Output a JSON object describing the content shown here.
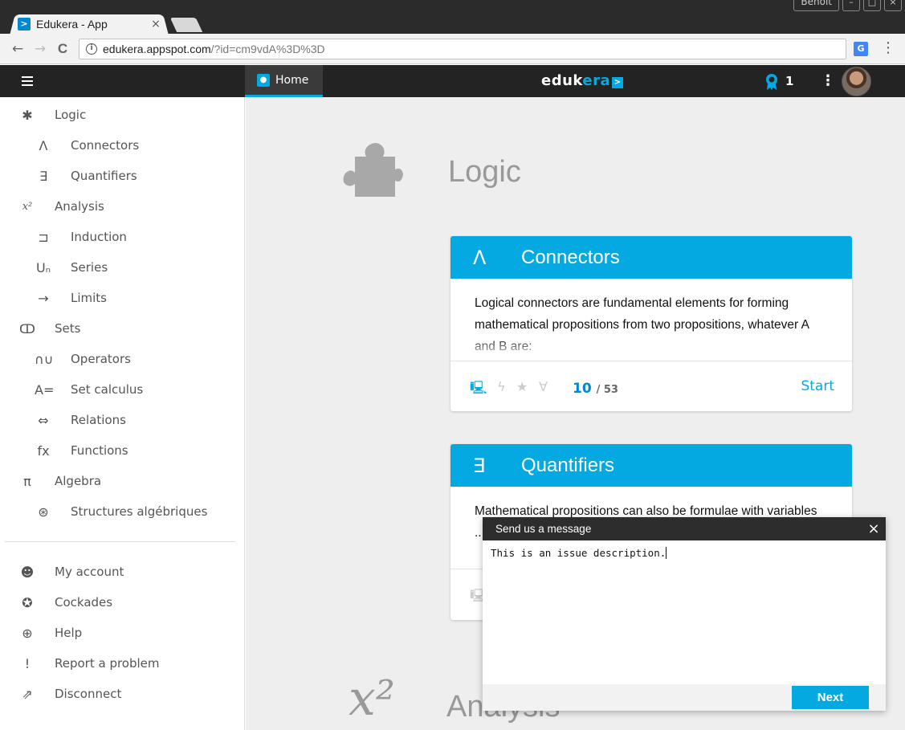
{
  "browser": {
    "tab_title": "Edukera - App",
    "tab_close": "×",
    "favicon_glyph": ">",
    "window_user": "Benoit",
    "url_host": "edukera.appspot.com",
    "url_path": "/?id=cm9vdA%3D%3D",
    "back_glyph": "←",
    "forward_glyph": "→",
    "reload_glyph": "C",
    "info_glyph": "i",
    "menu_glyph": "⋮",
    "translate_glyph": "G"
  },
  "header": {
    "home_label": "Home",
    "brand_a": "eduk",
    "brand_b": "era",
    "brand_mark": ">",
    "badge_count": "1",
    "more_glyph": "⋮"
  },
  "sidebar": {
    "items": [
      {
        "icon": "puzzle-icon",
        "glyph": "✱",
        "label": "Logic",
        "level": 0
      },
      {
        "icon": "and-icon",
        "glyph": "Λ",
        "label": "Connectors",
        "level": 1
      },
      {
        "icon": "exists-icon",
        "glyph": "∃",
        "label": "Quantifiers",
        "level": 1
      },
      {
        "icon": "x-squared-icon",
        "glyph": "x²",
        "label": "Analysis",
        "level": 0
      },
      {
        "icon": "induction-icon",
        "glyph": "⊐",
        "label": "Induction",
        "level": 1
      },
      {
        "icon": "series-icon",
        "glyph": "Uₙ",
        "label": "Series",
        "level": 1
      },
      {
        "icon": "arrow-right-icon",
        "glyph": "→",
        "label": "Limits",
        "level": 1
      },
      {
        "icon": "venn-icon",
        "glyph": "ↀ",
        "label": "Sets",
        "level": 0
      },
      {
        "icon": "operators-icon",
        "glyph": "∩∪",
        "label": "Operators",
        "level": 1
      },
      {
        "icon": "set-calculus-icon",
        "glyph": "A=",
        "label": "Set calculus",
        "level": 1
      },
      {
        "icon": "relations-icon",
        "glyph": "⇔",
        "label": "Relations",
        "level": 1
      },
      {
        "icon": "function-icon",
        "glyph": "fx",
        "label": "Functions",
        "level": 1
      },
      {
        "icon": "pi-icon",
        "glyph": "π",
        "label": "Algebra",
        "level": 0
      },
      {
        "icon": "structures-icon",
        "glyph": "⊛",
        "label": "Structures algébriques",
        "level": 1
      }
    ],
    "account_items": [
      {
        "icon": "user-icon",
        "glyph": "☻",
        "label": "My account"
      },
      {
        "icon": "cockade-icon",
        "glyph": "✪",
        "label": "Cockades"
      },
      {
        "icon": "help-icon",
        "glyph": "⊕",
        "label": "Help"
      },
      {
        "icon": "exclamation-icon",
        "glyph": "!",
        "label": "Report a problem"
      },
      {
        "icon": "logout-icon",
        "glyph": "⇗",
        "label": "Disconnect"
      }
    ]
  },
  "main": {
    "section_title": "Logic",
    "section2_title": "Analysis",
    "section2_glyph": "x²",
    "cards": [
      {
        "symbol": "Λ",
        "title": "Connectors",
        "body": "Logical connectors are fundamental elements for forming mathematical propositions from two propositions, whatever A and B are:",
        "progress": "10",
        "total": "/ 53",
        "start_label": "Start"
      },
      {
        "symbol": "∃",
        "title": "Quantifiers",
        "body": "Mathematical propositions can also be formulae with variables ... n",
        "progress": "",
        "total": "",
        "start_label": ""
      }
    ]
  },
  "dialog": {
    "title": "Send us a message",
    "close_glyph": "×",
    "text": "This is an issue description.",
    "next_label": "Next"
  },
  "colors": {
    "accent": "#03a9e0",
    "appbar": "#232323",
    "dialog_header": "#2d2d2d"
  }
}
